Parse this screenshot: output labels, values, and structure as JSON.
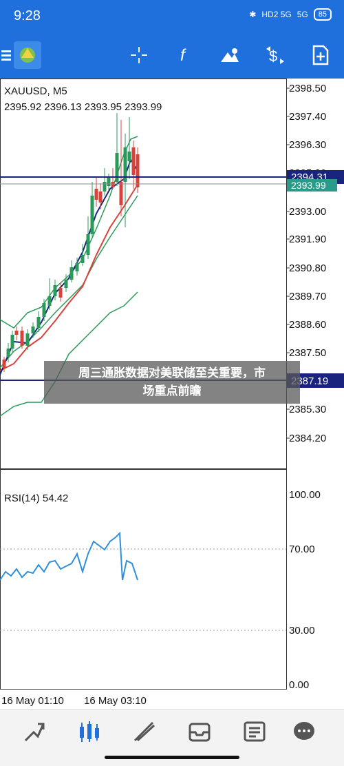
{
  "status_bar": {
    "time": "9:28",
    "network_1": "HD2 5G",
    "network_2": "5G",
    "battery": "85",
    "icons": [
      "bluetooth-icon",
      "signal-icon",
      "signal-icon",
      "battery-icon"
    ]
  },
  "toolbar": {
    "icons": [
      "menu-icon",
      "app-logo-icon",
      "crosshair-icon",
      "function-icon",
      "objects-icon",
      "trade-icon",
      "new-chart-icon"
    ],
    "accent_color": "#1f6fdc"
  },
  "chart": {
    "symbol_line": "XAUUSD, M5",
    "ohlc_line": "2395.92 2396.13 2393.95 2393.99",
    "price_labels": [
      "2398.50",
      "2397.40",
      "2396.30",
      "2395.20",
      "2393.00",
      "2391.90",
      "2390.80",
      "2389.70",
      "2388.60",
      "2387.50",
      "2386.40",
      "2385.30",
      "2384.20"
    ],
    "price_tag_top": "2394.31",
    "price_tag_bid": "2393.99",
    "price_tag_bottom": "2387.19",
    "rsi_label": "RSI(14) 54.42",
    "rsi_levels": [
      "100.00",
      "70.00",
      "30.00",
      "0.00"
    ],
    "time_labels": [
      "16 May 01:10",
      "16 May 03:10"
    ],
    "up_color": "#2a9a5a",
    "down_color": "#d7433c",
    "line_color": "#1a237e"
  },
  "overlay": {
    "headline_line1": "周三通胀数据对美联储至关重要，市",
    "headline_line2": "场重点前瞻"
  },
  "bottom_nav": {
    "items": [
      "quotes-icon",
      "chart-icon",
      "trade-icon",
      "history-icon",
      "news-icon",
      "messages-icon"
    ],
    "active": "chart-icon"
  }
}
